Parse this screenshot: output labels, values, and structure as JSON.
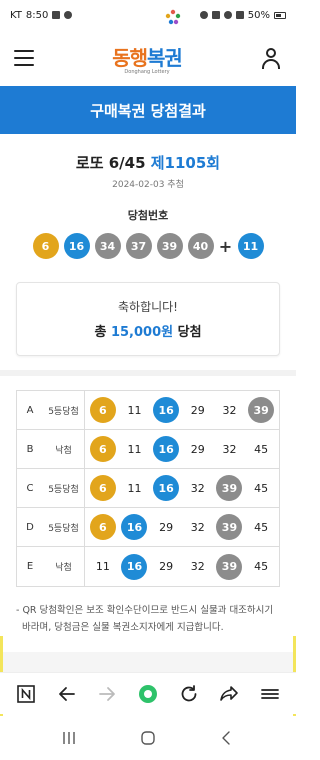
{
  "status_bar": {
    "carrier": "KT",
    "time": "8:50",
    "battery": "50%"
  },
  "header": {
    "logo_part1": "동행",
    "logo_part2": "복권",
    "logo_sub": "Donghang Lottery"
  },
  "banner": {
    "title": "구매복권 당첨결과"
  },
  "draw": {
    "game_name": "로또 6/45",
    "round": "제1105회",
    "date": "2024-02-03 추첨",
    "win_label": "당첨번호",
    "numbers": [
      {
        "value": "6",
        "color": "#e2a51c"
      },
      {
        "value": "16",
        "color": "#1f8bd6"
      },
      {
        "value": "34",
        "color": "#8c8c8c"
      },
      {
        "value": "37",
        "color": "#8c8c8c"
      },
      {
        "value": "39",
        "color": "#8c8c8c"
      },
      {
        "value": "40",
        "color": "#8c8c8c"
      }
    ],
    "plus": "+",
    "bonus": {
      "value": "11",
      "color": "#1f8bd6"
    }
  },
  "congrats": {
    "message": "축하합니다!",
    "prize_prefix": "총",
    "prize_amount": "15,000원",
    "prize_suffix": "당첨"
  },
  "games": [
    {
      "letter": "A",
      "result": "5등당첨",
      "nums": [
        {
          "v": "6",
          "c": "yellow"
        },
        {
          "v": "11",
          "c": ""
        },
        {
          "v": "16",
          "c": "blue"
        },
        {
          "v": "29",
          "c": ""
        },
        {
          "v": "32",
          "c": ""
        },
        {
          "v": "39",
          "c": "gray"
        }
      ]
    },
    {
      "letter": "B",
      "result": "낙첨",
      "nums": [
        {
          "v": "6",
          "c": "yellow"
        },
        {
          "v": "11",
          "c": ""
        },
        {
          "v": "16",
          "c": "blue"
        },
        {
          "v": "29",
          "c": ""
        },
        {
          "v": "32",
          "c": ""
        },
        {
          "v": "45",
          "c": ""
        }
      ]
    },
    {
      "letter": "C",
      "result": "5등당첨",
      "nums": [
        {
          "v": "6",
          "c": "yellow"
        },
        {
          "v": "11",
          "c": ""
        },
        {
          "v": "16",
          "c": "blue"
        },
        {
          "v": "32",
          "c": ""
        },
        {
          "v": "39",
          "c": "gray"
        },
        {
          "v": "45",
          "c": ""
        }
      ]
    },
    {
      "letter": "D",
      "result": "5등당첨",
      "nums": [
        {
          "v": "6",
          "c": "yellow"
        },
        {
          "v": "16",
          "c": "blue"
        },
        {
          "v": "29",
          "c": ""
        },
        {
          "v": "32",
          "c": ""
        },
        {
          "v": "39",
          "c": "gray"
        },
        {
          "v": "45",
          "c": ""
        }
      ]
    },
    {
      "letter": "E",
      "result": "낙첨",
      "nums": [
        {
          "v": "11",
          "c": ""
        },
        {
          "v": "16",
          "c": "blue"
        },
        {
          "v": "29",
          "c": ""
        },
        {
          "v": "32",
          "c": ""
        },
        {
          "v": "39",
          "c": "gray"
        },
        {
          "v": "45",
          "c": ""
        }
      ]
    }
  ],
  "notice": {
    "line1": "- QR 당첨확인은 보조 확인수단이므로 반드시 실물과 대조하시기",
    "line2": "바라며, 당첨금은 실물 복권소지자에게 지급합니다."
  },
  "browser_toolbar": {
    "icons": [
      "naver-icon",
      "back-arrow-icon",
      "forward-arrow-icon",
      "home-dot-icon",
      "refresh-icon",
      "share-icon",
      "menu-icon"
    ]
  },
  "nav_bar": {
    "icons": [
      "recent-apps-icon",
      "home-icon",
      "back-icon"
    ]
  }
}
